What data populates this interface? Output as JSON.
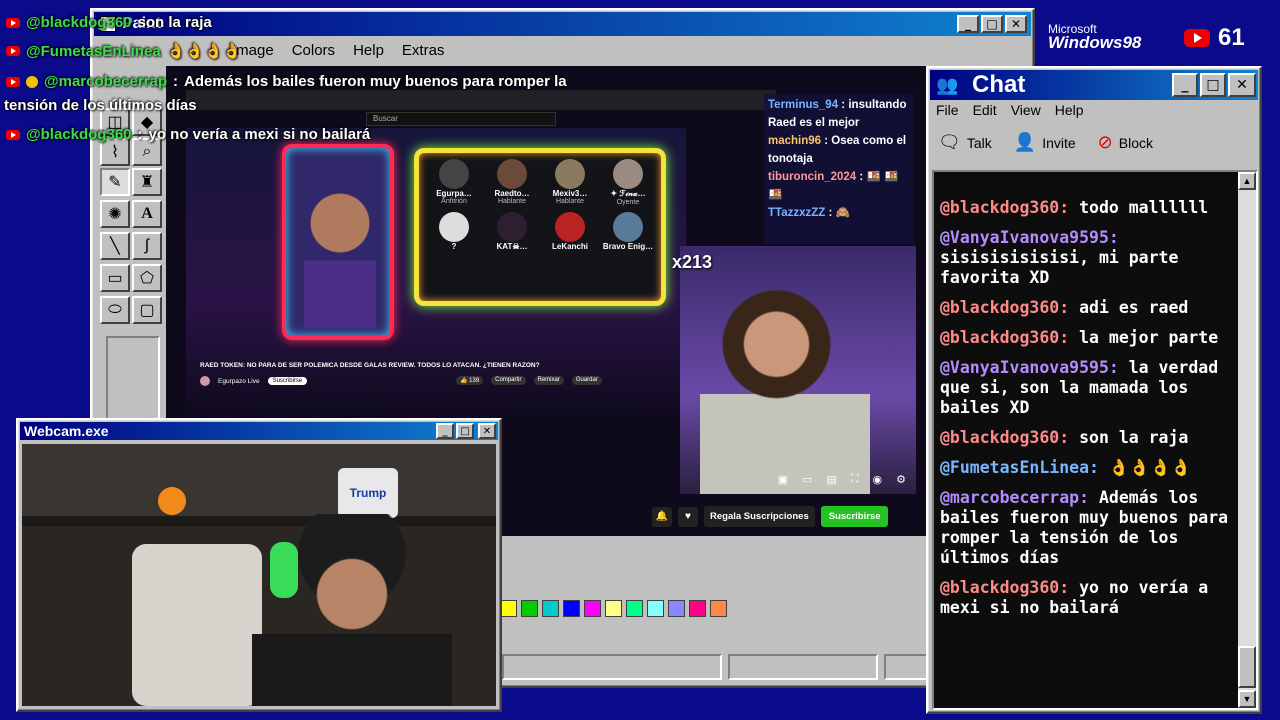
{
  "desktop": {
    "brand_top": "Microsoft",
    "brand_main": "Windows98",
    "subscriber_count": "61"
  },
  "overlay_chat": [
    {
      "user": "@blackdog360",
      "sep": ":",
      "text": "son la raja"
    },
    {
      "user": "@FumetasEnLinea",
      "sep": ":",
      "text": "👌👌👌👌"
    },
    {
      "user": "@marcobecerrap",
      "sep": ":",
      "text": "Además los bailes fueron muy buenos para romper la"
    },
    {
      "user": "",
      "sep": "",
      "text": "tensión de los últimos días"
    },
    {
      "user": "@blackdog360",
      "sep": ":",
      "text": "yo no vería a mexi si no bailará"
    }
  ],
  "paint": {
    "title": "Paint",
    "menu": [
      "Image",
      "Colors",
      "Help",
      "Extras"
    ],
    "tools": [
      "eraser-tool",
      "fill-tool",
      "select-tool",
      "zoom-tool",
      "pencil-tool",
      "brush-tool",
      "airbrush-tool",
      "text-tool",
      "line-tool",
      "curve-tool",
      "rectangle-tool",
      "polygon-tool",
      "ellipse-tool",
      "rounded-rect-tool"
    ],
    "palette": [
      "#ffff00",
      "#00cc00",
      "#00cccc",
      "#0000ff",
      "#ff00ff",
      "#ffff88",
      "#00ff88",
      "#88ffff",
      "#8888ff",
      "#ff0088",
      "#ff8844"
    ]
  },
  "stream": {
    "video_title": "RAED TOKEN: NO PARA DE SER POLEMICA DESDE GALAS REVIEW. TODOS LO ATACAN. ¿TIENEN RAZON?",
    "search_placeholder": "Buscar",
    "channel_name": "Egurpazo Live",
    "subscribe_small": "Suscribirse",
    "likes": "139",
    "share": "Compartir",
    "remix": "Remixar",
    "save": "Guardar",
    "gift_button": "Regala Suscripciones",
    "subscribe_button": "Suscribirse",
    "bell": "bell-icon",
    "heart": "heart-icon",
    "host_name": "x213",
    "participants": [
      {
        "name": "Egurpa…",
        "role": "Anfitrión"
      },
      {
        "name": "Raedto…",
        "role": "Hablante"
      },
      {
        "name": "Mexiv3…",
        "role": "Hablante"
      },
      {
        "name": "✦ ℱ𝒾𝓃𝒶…",
        "role": "Oyente"
      },
      {
        "name": "?",
        "role": ""
      },
      {
        "name": "KAT☠…",
        "role": ""
      },
      {
        "name": "LeKanchi",
        "role": ""
      },
      {
        "name": "Bravo Enig…",
        "role": ""
      }
    ]
  },
  "yt_chat": [
    {
      "user": "Terminus_94",
      "text": "insultando Raed es el mejor"
    },
    {
      "user": "machin96",
      "text": "Osea como el tonotaja"
    },
    {
      "user": "tiburoncin_2024",
      "text": "🍱 🍱 🍱"
    },
    {
      "user": "TTazzxzZZ",
      "text": "🙈"
    }
  ],
  "webcam": {
    "title": "Webcam.exe",
    "brand_label": "Trump"
  },
  "chat_window": {
    "title": "Chat",
    "menu": [
      "File",
      "Edit",
      "View",
      "Help"
    ],
    "toolbar": [
      {
        "label": "Talk",
        "icon": "talk-icon"
      },
      {
        "label": "Invite",
        "icon": "invite-icon"
      },
      {
        "label": "Block",
        "icon": "block-icon"
      }
    ],
    "messages": [
      {
        "user": "@blackdog360:",
        "text": "todo mallllll",
        "color": "#ff8a8a"
      },
      {
        "user": "@VanyaIvanova9595:",
        "text": "sisisisisisisi, mi parte favorita XD",
        "color": "#b48cff"
      },
      {
        "user": "@blackdog360:",
        "text": "adi es raed",
        "color": "#ff8a8a"
      },
      {
        "user": "@blackdog360:",
        "text": "la mejor parte",
        "color": "#ff8a8a"
      },
      {
        "user": "@VanyaIvanova9595:",
        "text": "la verdad que si, son la mamada los bailes XD",
        "color": "#b48cff"
      },
      {
        "user": "@blackdog360:",
        "text": "son la raja",
        "color": "#ff8a8a"
      },
      {
        "user": "@FumetasEnLinea:",
        "text": "👌👌👌👌",
        "color": "#7ab6ff"
      },
      {
        "user": "@marcobecerrap:",
        "text": "Además los bailes fueron muy buenos para romper la tensión de los últimos días",
        "color": "#b48cff"
      },
      {
        "user": "@blackdog360:",
        "text": "yo no vería a mexi si no bailará",
        "color": "#ff8a8a"
      }
    ]
  }
}
